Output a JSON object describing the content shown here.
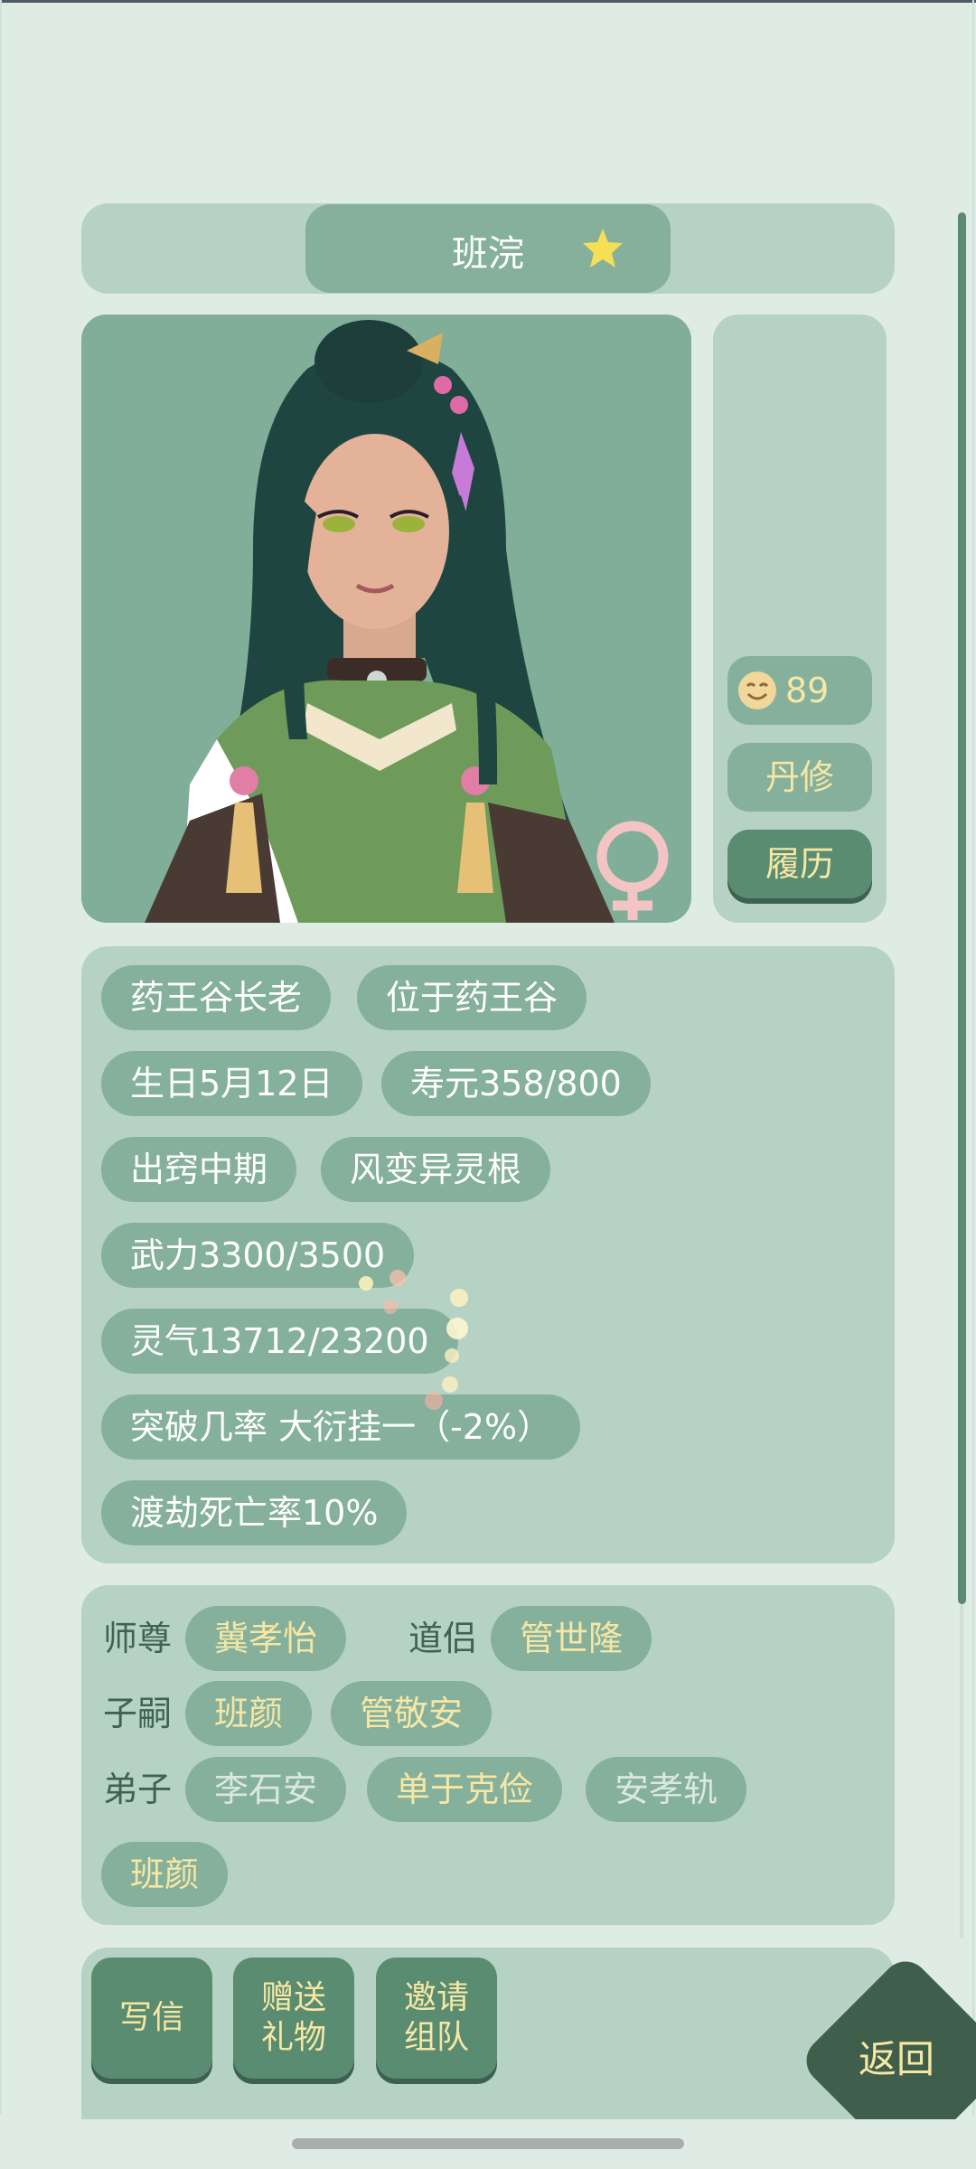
{
  "header": {
    "name": "班浣"
  },
  "side": {
    "mood_value": "89",
    "cultivation_btn": "丹修",
    "history_btn": "履历"
  },
  "tags": {
    "row1": [
      "药王谷长老",
      "位于药王谷"
    ],
    "row2": [
      "生日5月12日",
      "寿元358/800"
    ],
    "row3": [
      "出窍中期",
      "风变异灵根"
    ],
    "row4": "武力3300/3500",
    "row5": "灵气13712/23200",
    "row6": "突破几率 大衍挂一（-2%）",
    "row7": "渡劫死亡率10%"
  },
  "relations": {
    "master_label": "师尊",
    "master": "冀孝怡",
    "partner_label": "道侣",
    "partner": "管世隆",
    "children_label": "子嗣",
    "children": [
      "班颜",
      "管敬安"
    ],
    "disciples_label": "弟子",
    "disciples": [
      "李石安",
      "单于克俭",
      "安孝轨",
      "班颜"
    ]
  },
  "actions": {
    "write_letter": "写信",
    "gift_1": "赠送",
    "gift_2": "礼物",
    "invite_1": "邀请",
    "invite_2": "组队",
    "back": "返回"
  },
  "colors": {
    "panel": "#b6d2c5",
    "chip": "#85b09c",
    "accent_yellow": "#f6e7a4",
    "dark_green": "#3f5e4c",
    "female_symbol": "#f2c4c4"
  }
}
